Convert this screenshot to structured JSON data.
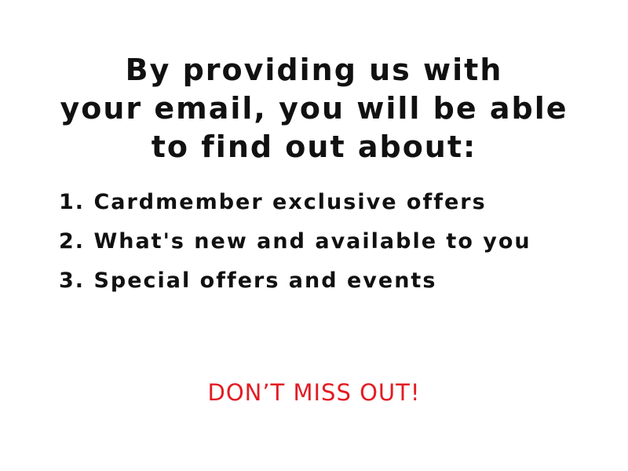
{
  "headline": {
    "line1": "By providing us with",
    "line2": "your email, you will be able",
    "line3": "to find out about:"
  },
  "benefits": [
    "1. Cardmember exclusive offers",
    "2. What's new and available to you",
    "3. Special offers and events"
  ],
  "cta": {
    "text": "DON’T MISS OUT!",
    "color": "#e31b23"
  },
  "colors": {
    "text": "#111111",
    "background": "#ffffff"
  }
}
